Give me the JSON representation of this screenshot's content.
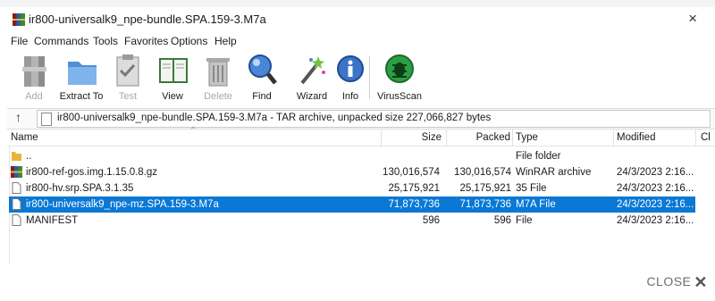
{
  "window": {
    "title": "ir800-universalk9_npe-bundle.SPA.159-3.M7a",
    "close_glyph": "×"
  },
  "menu": [
    "File",
    "Commands",
    "Tools",
    "Favorites",
    "Options",
    "Help"
  ],
  "toolbar": [
    {
      "label": "Add",
      "icon": "add-archive-icon",
      "disabled": true
    },
    {
      "label": "Extract To",
      "icon": "extract-folder-icon",
      "disabled": false
    },
    {
      "label": "Test",
      "icon": "test-clipboard-icon",
      "disabled": true
    },
    {
      "label": "View",
      "icon": "view-book-icon",
      "disabled": false
    },
    {
      "label": "Delete",
      "icon": "delete-trash-icon",
      "disabled": true
    },
    {
      "label": "Find",
      "icon": "find-magnifier-icon",
      "disabled": false
    },
    {
      "label": "Wizard",
      "icon": "wizard-wand-icon",
      "disabled": false
    },
    {
      "label": "Info",
      "icon": "info-icon",
      "disabled": false
    },
    {
      "label": "VirusScan",
      "icon": "virus-scan-icon",
      "disabled": false
    }
  ],
  "address": {
    "up_glyph": "↑",
    "path": "ir800-universalk9_npe-bundle.SPA.159-3.M7a - TAR archive, unpacked size 227,066,827 bytes"
  },
  "columns": {
    "name": "Name",
    "size": "Size",
    "packed": "Packed",
    "type": "Type",
    "modified": "Modified",
    "crc": "Cl"
  },
  "files": [
    {
      "name": "..",
      "size": "",
      "packed": "",
      "type": "File folder",
      "modified": "",
      "icon": "folder-icon",
      "selected": false
    },
    {
      "name": "ir800-ref-gos.img.1.15.0.8.gz",
      "size": "130,016,574",
      "packed": "130,016,574",
      "type": "WinRAR archive",
      "modified": "24/3/2023 2:16...",
      "icon": "rar-archive-icon",
      "selected": false
    },
    {
      "name": "ir800-hv.srp.SPA.3.1.35",
      "size": "25,175,921",
      "packed": "25,175,921",
      "type": "35 File",
      "modified": "24/3/2023 2:16...",
      "icon": "file-icon",
      "selected": false
    },
    {
      "name": "ir800-universalk9_npe-mz.SPA.159-3.M7a",
      "size": "71,873,736",
      "packed": "71,873,736",
      "type": "M7A File",
      "modified": "24/3/2023 2:16...",
      "icon": "file-icon",
      "selected": true
    },
    {
      "name": "MANIFEST",
      "size": "596",
      "packed": "596",
      "type": "File",
      "modified": "24/3/2023 2:16...",
      "icon": "file-icon",
      "selected": false
    }
  ],
  "close_label": "CLOSE",
  "close_icon": "✕",
  "colors": {
    "selection": "#0a78d4",
    "disabled_text": "#a8a8a8"
  }
}
